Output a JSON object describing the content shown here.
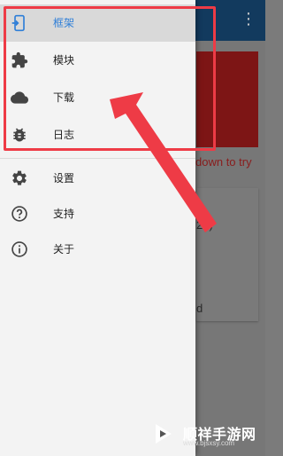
{
  "background": {
    "hint_text": "down to try",
    "number_text": "28)",
    "tail_text": "d"
  },
  "drawer": {
    "primary_items": [
      {
        "label": "框架",
        "icon": "framework-icon",
        "selected": true
      },
      {
        "label": "模块",
        "icon": "puzzle-icon",
        "selected": false
      },
      {
        "label": "下载",
        "icon": "cloud-icon",
        "selected": false
      },
      {
        "label": "日志",
        "icon": "bug-icon",
        "selected": false
      }
    ],
    "secondary_items": [
      {
        "label": "设置",
        "icon": "gear-icon"
      },
      {
        "label": "支持",
        "icon": "help-icon"
      },
      {
        "label": "关于",
        "icon": "info-icon"
      }
    ]
  },
  "colors": {
    "accent": "#2f7fd8",
    "highlight": "#ee3b46",
    "appbar": "#123a5e",
    "dim_bg": "#777777"
  },
  "watermark": {
    "title": "顺祥手游网",
    "url": "www.bjsxsy.com"
  }
}
